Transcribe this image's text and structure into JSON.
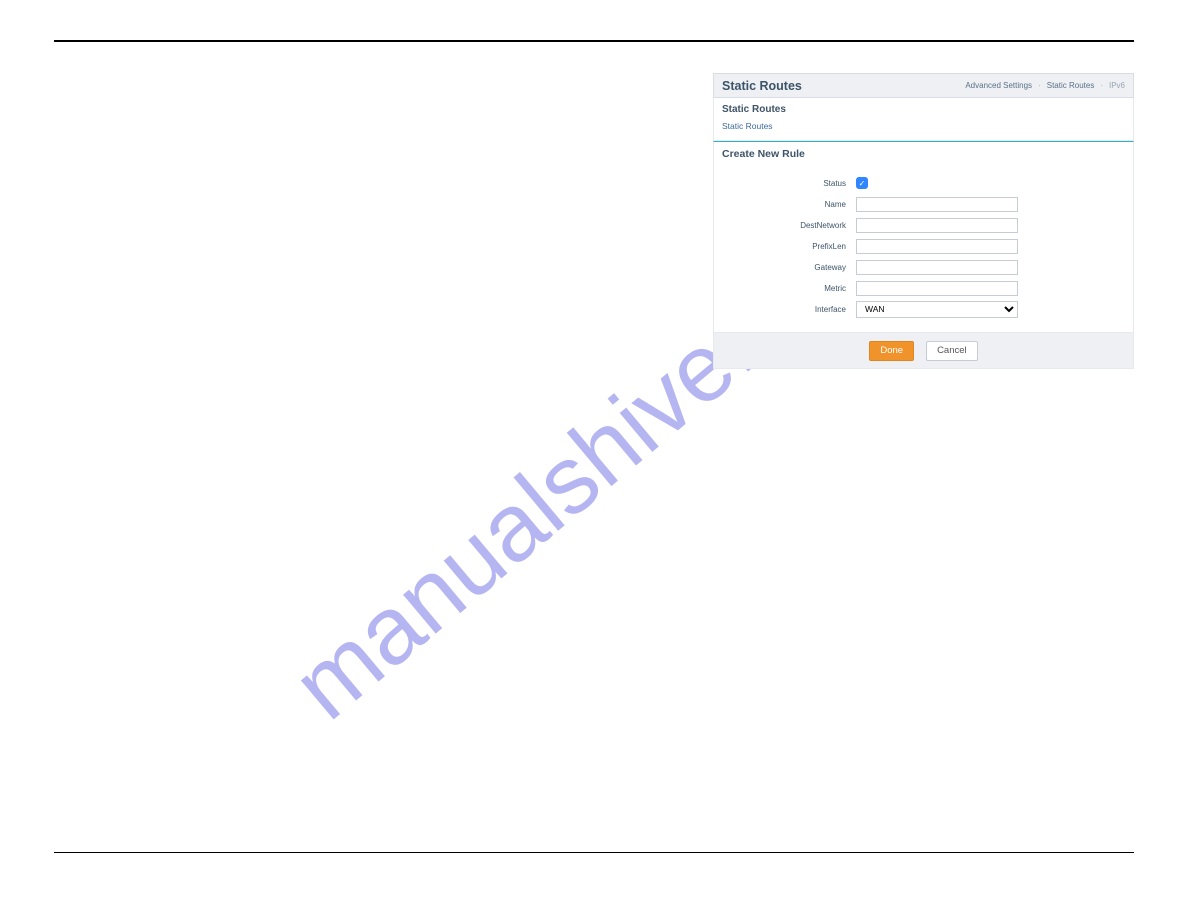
{
  "watermark": "manualshive.com",
  "panel": {
    "title": "Static Routes",
    "breadcrumb": {
      "a": "Advanced Settings",
      "b": "Static Routes",
      "current": "IPv6"
    },
    "sub": {
      "title": "Static Routes",
      "link": "Static Routes"
    }
  },
  "form": {
    "heading": "Create New Rule",
    "labels": {
      "status": "Status",
      "name": "Name",
      "destnetwork": "DestNetwork",
      "prefixlen": "PrefixLen",
      "gateway": "Gateway",
      "metric": "Metric",
      "interface": "Interface"
    },
    "values": {
      "status_checked": "✓",
      "name": "",
      "destnetwork": "",
      "prefixlen": "",
      "gateway": "",
      "metric": "",
      "interface_selected": "WAN"
    }
  },
  "buttons": {
    "done": "Done",
    "cancel": "Cancel"
  }
}
